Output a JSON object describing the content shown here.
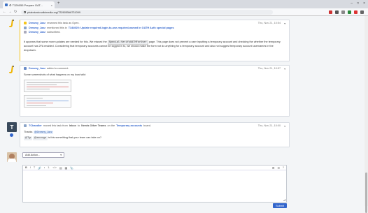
{
  "browser": {
    "tab_title": "⚙ T326055 Prepare OAT...",
    "tab_close": "×",
    "new_tab": "+",
    "url": "phabricator.wikimedia.org/T326055#8731099"
  },
  "events": [
    {
      "user": "Dreamy_Jazz",
      "action_top": "renamed this task as Open.",
      "action_mid_prefix": "mentioned this in",
      "action_mid_link": "T344920: Update required-login-to-use-required-named in OATH Auth special pages",
      "action_low": "subscribed.",
      "time": "Thu, Nov 21, 10:54",
      "body": "It appears that some more updates are needed for this. We missed the",
      "body_code": "Special:VerifyOATHForUser",
      "body_rest": "page. This page does not prevent a user inputting a temporary account and checking the whether the temporary account has 2FA enabled. Considering that temporary accounts cannot be logged in to, we should make the form not do anything for a temporary account and also not suggest temporary account usernames in the dropdown."
    },
    {
      "user": "Dreamy_Jazz",
      "action": "added a comment.",
      "time": "Thu, Nov 21, 10:57",
      "body": "Some screenshots of what happens on my local wiki:"
    },
    {
      "user": "TChandler",
      "action_prefix": "moved this task from",
      "from": "Inbox",
      "to_prefix": "to",
      "to": "Needs Other Teams",
      "on_prefix": "on the",
      "board": "Temporary accounts",
      "board_suffix": "board.",
      "time": "Thu, Nov 21, 10:00",
      "thanks_prefix": "Thanks",
      "mention": "@Dreamy_Jazz",
      "ping1": "@Tgr",
      "ping2": "@aanzaga",
      "question": "is this something that your team can take on?"
    }
  ],
  "composer": {
    "add_action": "Add Action...",
    "submit": "Submit",
    "toolbar": [
      "B",
      "I",
      "T",
      "🔗",
      "•",
      "1.",
      "</>",
      "▤",
      "▦",
      "📎",
      "⌘",
      "☰"
    ]
  },
  "colors": {
    "link": "#3366cc",
    "accent_yellow": "#f5c518"
  }
}
